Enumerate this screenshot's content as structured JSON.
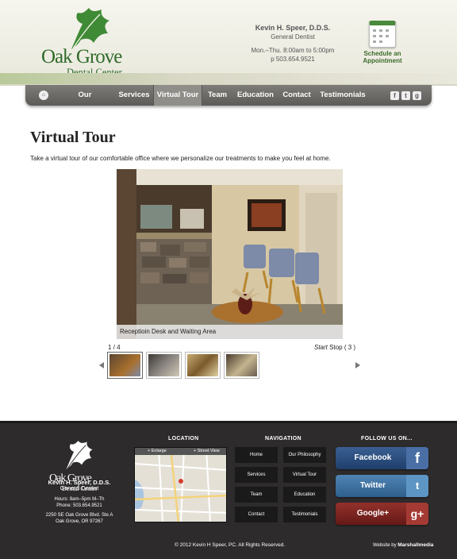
{
  "header": {
    "logo_name": "Oak Grove",
    "logo_sub": "Dental Center",
    "doctor_name": "Kevin H. Speer, D.D.S.",
    "doctor_title": "General Dentist",
    "hours": "Mon.–Thu. 8:00am to 5:00pm",
    "phone": "p 503.654.9521",
    "schedule_line1": "Schedule an",
    "schedule_line2": "Appointment"
  },
  "nav": {
    "home_icon": "home-icon",
    "items": [
      {
        "label": "Our Philosophy"
      },
      {
        "label": "Services"
      },
      {
        "label": "Virtual Tour",
        "active": true
      },
      {
        "label": "Team"
      },
      {
        "label": "Education"
      },
      {
        "label": "Contact"
      },
      {
        "label": "Testimonials"
      }
    ],
    "social": [
      "facebook-icon",
      "twitter-icon",
      "google-plus-icon"
    ]
  },
  "main": {
    "title": "Virtual Tour",
    "intro": "Take a virtual tour of our comfortable office where we personalize our treatments to make you feel at home.",
    "caption": "Receptioin Desk and Waiting Area",
    "counter": "1 / 4",
    "start": "Start",
    "stop": "Stop",
    "countdown": "( 3 )"
  },
  "footer": {
    "logo_name": "Oak Grove",
    "logo_sub": "Dental Center",
    "doctor_name": "Kevin H. Speer, D.D.S.",
    "doctor_title": "General Dentist",
    "hours": "Hours: 8am–5pm M–Th",
    "phone": "Phone: 503.654.9521",
    "address1": "2250 SE Oak Grove Blvd. Ste A",
    "address2": "Oak Grove, OR 97267",
    "location_heading": "LOCATION",
    "map_enlarge": "+ Enlarge",
    "map_street": "+ Street View",
    "navigation_heading": "NAVIGATION",
    "nav_links": [
      "Home",
      "Our Philosophy",
      "Services",
      "Virtual Tour",
      "Team",
      "Education",
      "Contact",
      "Testimonials"
    ],
    "follow_heading": "FOLLOW US ON...",
    "facebook": "Facebook",
    "twitter": "Twitter",
    "google": "Google+",
    "copyright": "© 2012 Kevin H Speer, PC. All Rights Reserved.",
    "website_by": "Website by",
    "agency": "Marshallmedia"
  },
  "colors": {
    "brand_green": "#2f6b2a",
    "nav_gray": "#6a6965",
    "footer_bg": "#2d2b2b",
    "facebook": "#2c4d7a",
    "twitter": "#3a6f9e",
    "google": "#7a1f1c"
  }
}
